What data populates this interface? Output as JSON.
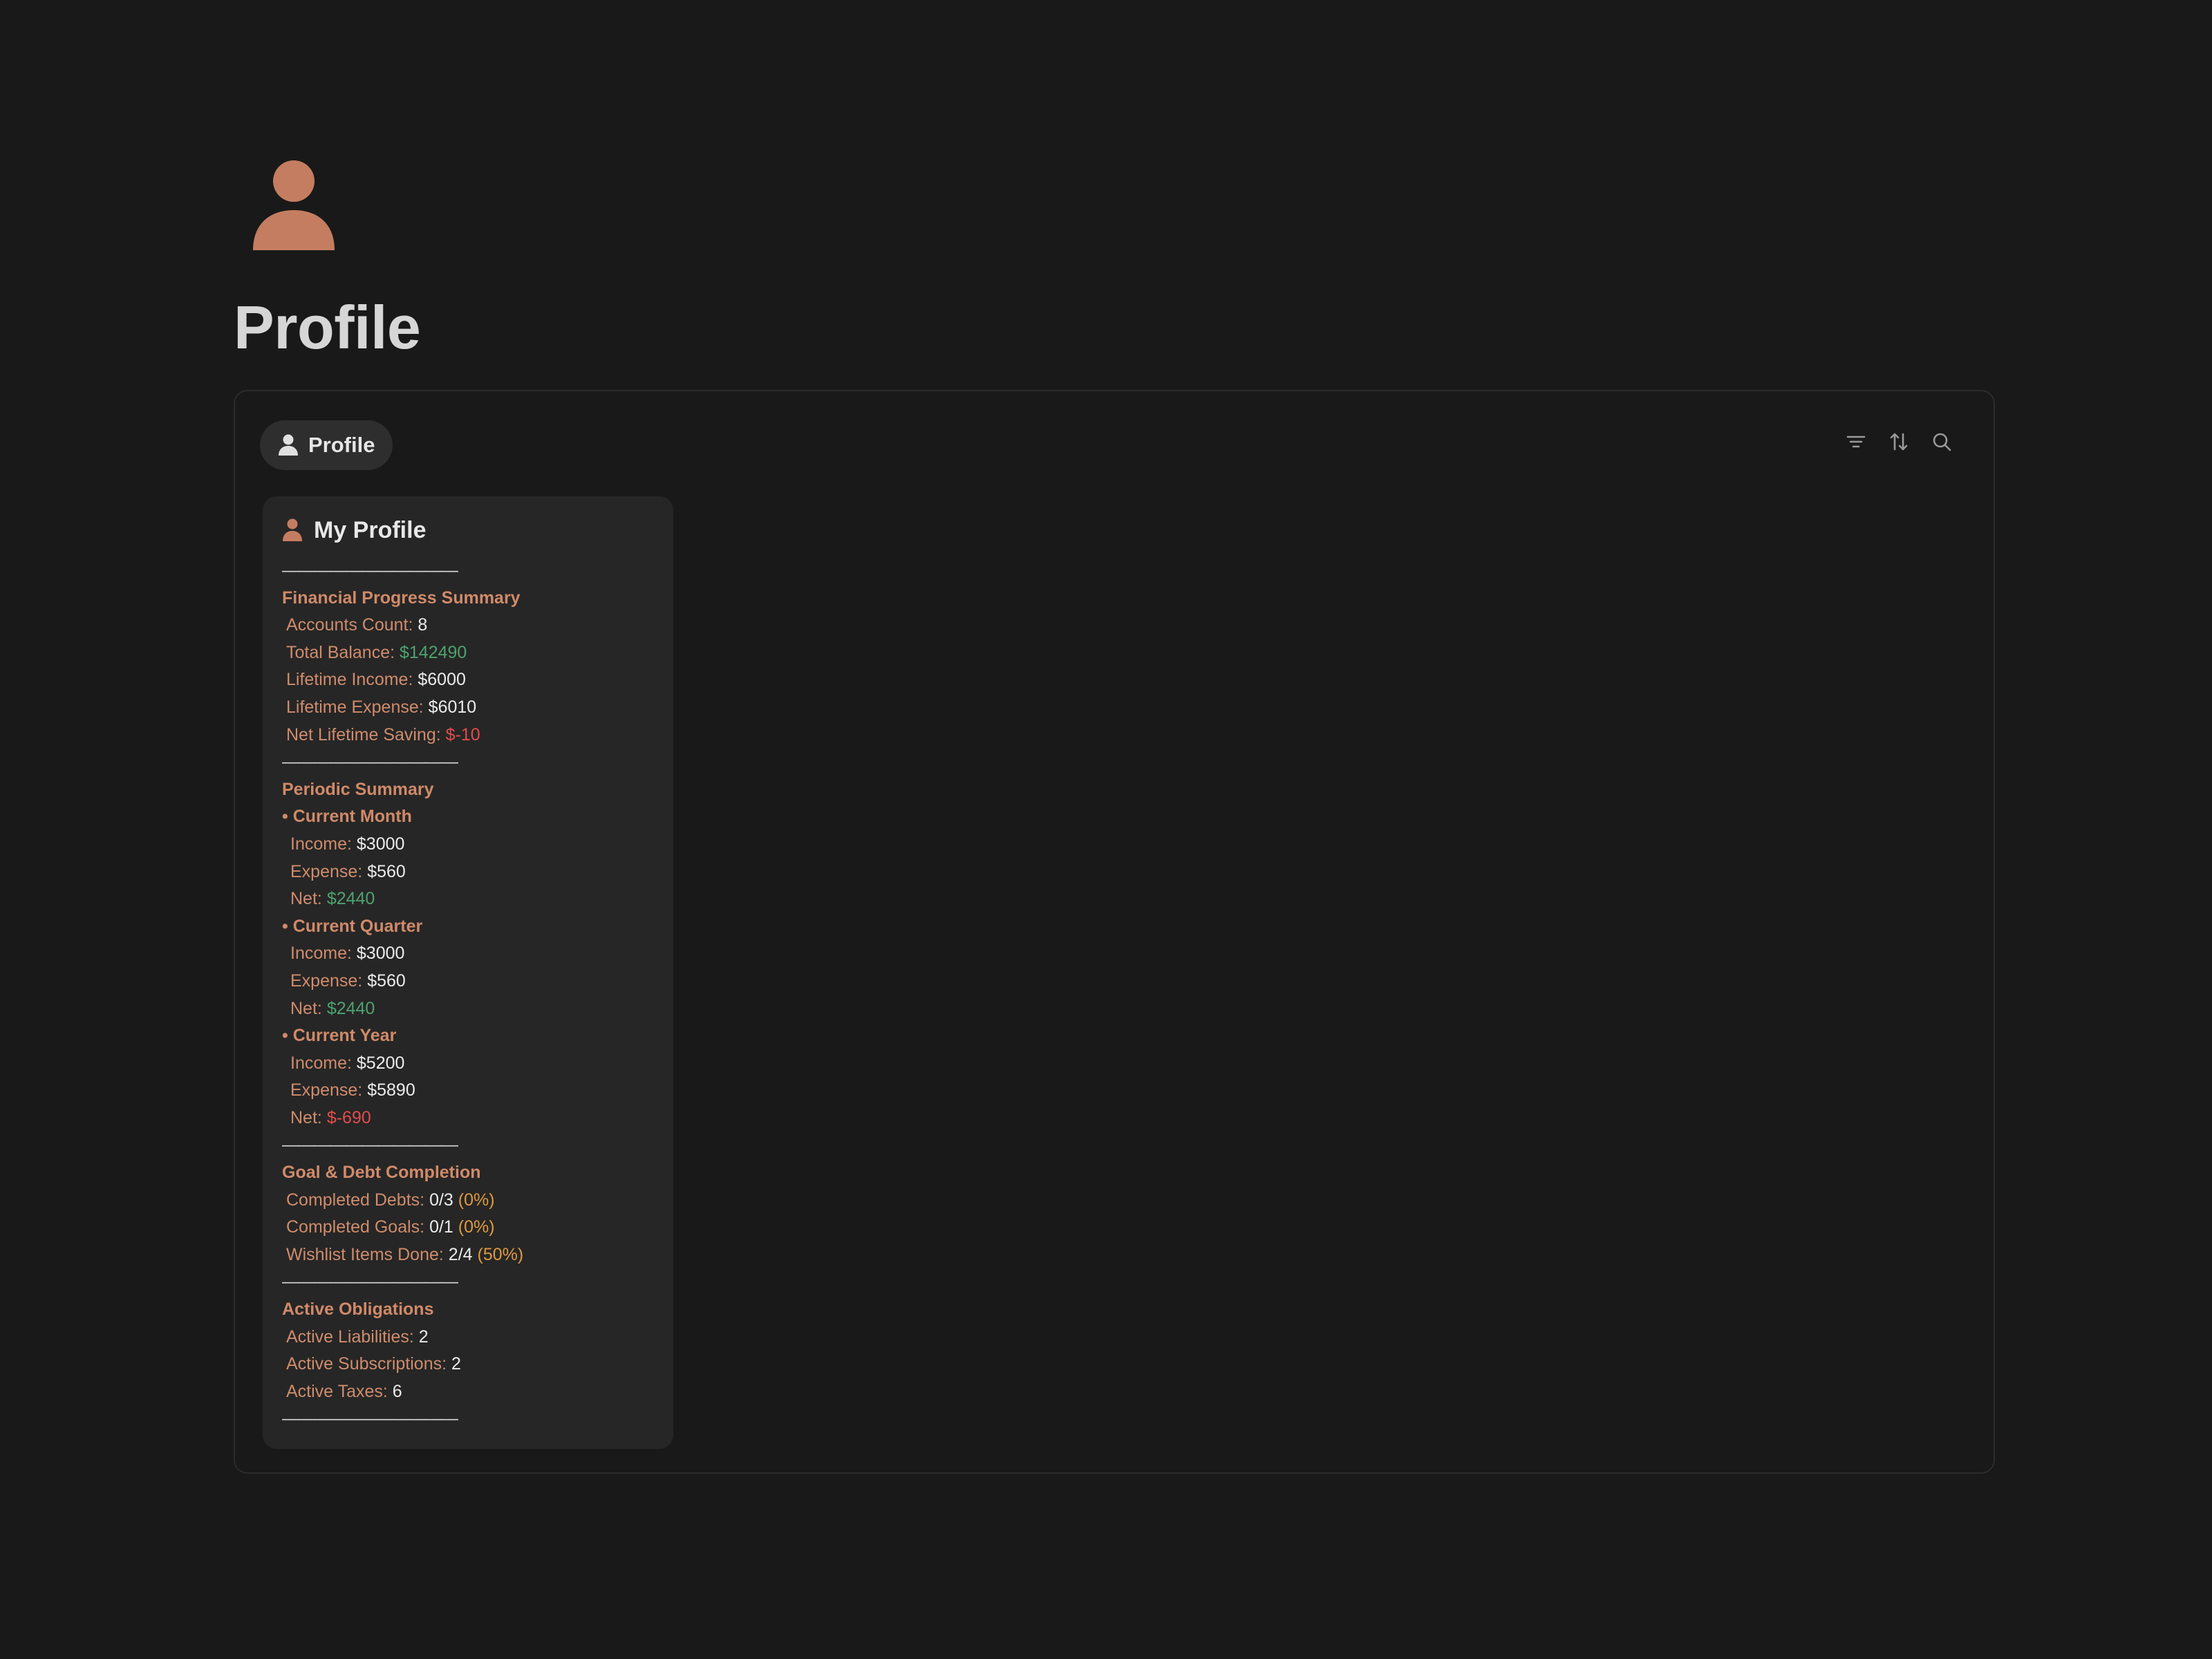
{
  "page": {
    "title": "Profile",
    "icon": "person-icon",
    "accent_color": "#c47d60"
  },
  "view": {
    "tab_label": "Profile",
    "tab_icon": "person-icon",
    "toolbar": [
      "filter-icon",
      "sort-icon",
      "search-icon"
    ]
  },
  "card": {
    "title": "My Profile",
    "separator": "———————————",
    "financial": {
      "title": "Financial Progress Summary",
      "rows": [
        {
          "label": "Accounts Count:",
          "value": "8"
        },
        {
          "label": "Total Balance:",
          "value": "$142490"
        },
        {
          "label": "Lifetime Income:",
          "value": "$6000"
        },
        {
          "label": "Lifetime Expense:",
          "value": "$6010"
        },
        {
          "label": "Net Lifetime Saving:",
          "value": "$-10"
        }
      ]
    },
    "periodic": {
      "title": "Periodic Summary",
      "periods": [
        {
          "name": "• Current Month",
          "income_label": "Income:",
          "income": "$3000",
          "expense_label": "Expense:",
          "expense": "$560",
          "net_label": "Net:",
          "net": "$2440"
        },
        {
          "name": "• Current Quarter",
          "income_label": "Income:",
          "income": "$3000",
          "expense_label": "Expense:",
          "expense": "$560",
          "net_label": "Net:",
          "net": "$2440"
        },
        {
          "name": "• Current Year",
          "income_label": "Income:",
          "income": "$5200",
          "expense_label": "Expense:",
          "expense": "$5890",
          "net_label": "Net:",
          "net": "$-690"
        }
      ]
    },
    "goals": {
      "title": "Goal & Debt Completion",
      "rows": [
        {
          "label": "Completed Debts:",
          "value": "0/3",
          "pct": "(0%)"
        },
        {
          "label": "Completed Goals:",
          "value": "0/1",
          "pct": "(0%)"
        },
        {
          "label": "Wishlist Items Done:",
          "value": "2/4",
          "pct": "(50%)"
        }
      ]
    },
    "obligations": {
      "title": "Active Obligations",
      "rows": [
        {
          "label": "Active Liabilities:",
          "value": "2"
        },
        {
          "label": "Active Subscriptions:",
          "value": "2"
        },
        {
          "label": "Active Taxes:",
          "value": "6"
        }
      ]
    }
  }
}
